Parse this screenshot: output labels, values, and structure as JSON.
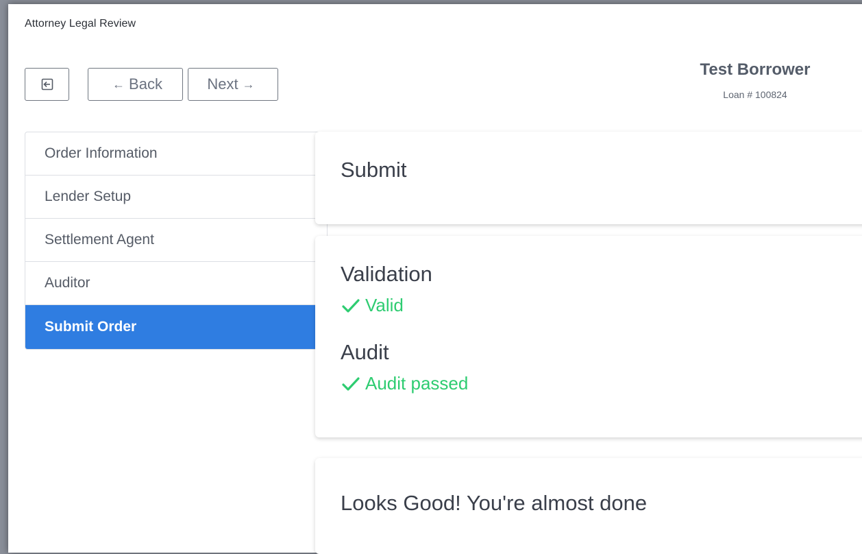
{
  "header": {
    "title": "Attorney Legal Review"
  },
  "toolbar": {
    "collapse_icon": "sidebar-collapse-icon",
    "back_arrow": "←",
    "back_label": "Back",
    "next_label": "Next",
    "next_arrow": "→"
  },
  "borrower": {
    "name": "Test Borrower",
    "loan": "Loan # 100824"
  },
  "sidebar": {
    "items": [
      {
        "label": "Order Information"
      },
      {
        "label": "Lender Setup"
      },
      {
        "label": "Settlement Agent"
      },
      {
        "label": "Auditor"
      },
      {
        "label": "Submit Order"
      }
    ],
    "active_index": 4
  },
  "main": {
    "submit_title": "Submit",
    "validation_title": "Validation",
    "validation_status": "Valid",
    "audit_title": "Audit",
    "audit_status": "Audit passed",
    "done_title": "Looks Good! You're almost done"
  },
  "colors": {
    "accent": "#2f7de1",
    "success": "#2ecc71"
  }
}
